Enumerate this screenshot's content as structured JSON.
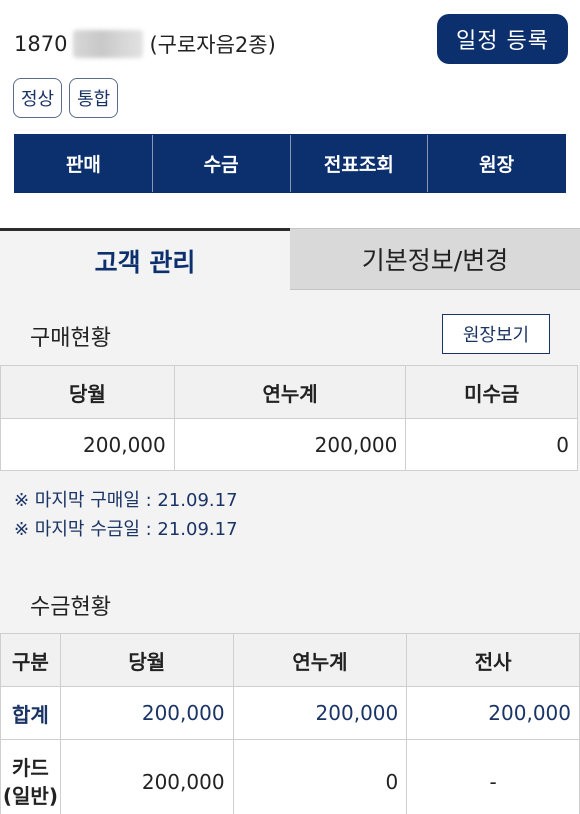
{
  "header": {
    "customer_code": "1870",
    "customer_suffix": "(구로자음2종)",
    "schedule_button": "일정 등록",
    "badges": [
      "정상",
      "통합"
    ]
  },
  "menu": {
    "items": [
      "판매",
      "수금",
      "전표조회",
      "원장"
    ]
  },
  "tabs": {
    "active": "고객 관리",
    "inactive": "기본정보/변경"
  },
  "purchase": {
    "title": "구매현황",
    "ledger_button": "원장보기",
    "columns": [
      "당월",
      "연누계",
      "미수금"
    ],
    "row": [
      "200,000",
      "200,000",
      "0"
    ]
  },
  "notes": {
    "last_purchase": "※ 마지막 구매일 : 21.09.17",
    "last_collection": "※ 마지막 수금일 : 21.09.17"
  },
  "collection": {
    "title": "수금현황",
    "columns": [
      "구분",
      "당월",
      "연누계",
      "전사"
    ],
    "total": {
      "label": "합계",
      "values": [
        "200,000",
        "200,000",
        "200,000"
      ]
    },
    "card": {
      "label_line1": "카드",
      "label_line2": "(일반)",
      "values": [
        "200,000",
        "0",
        "-"
      ]
    }
  }
}
